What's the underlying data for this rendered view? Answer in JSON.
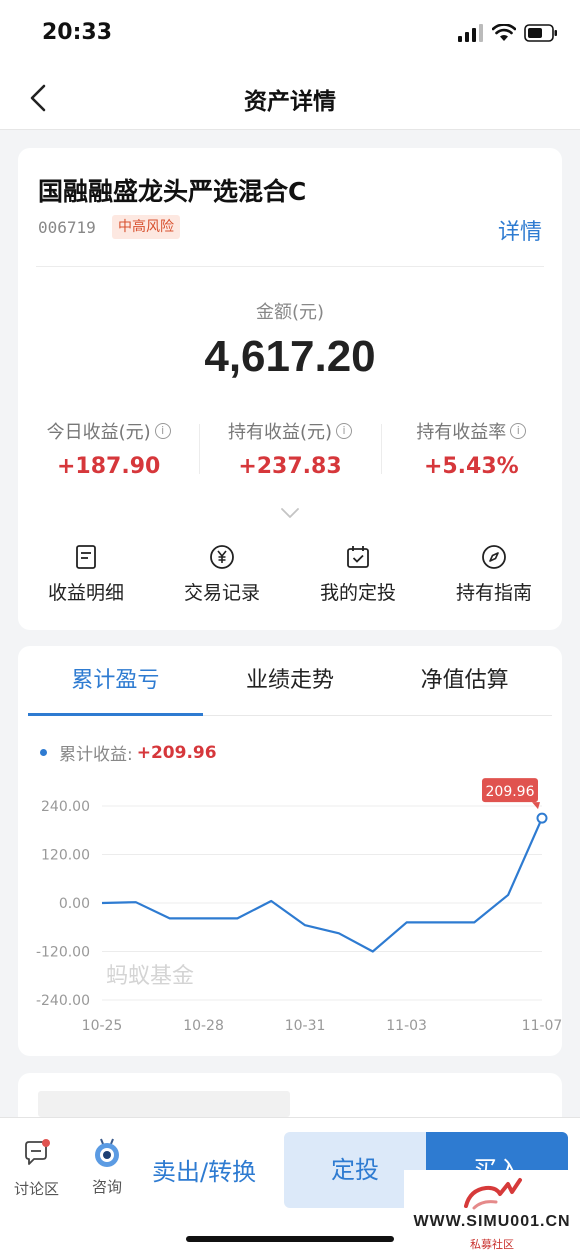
{
  "status_bar": {
    "time": "20:33"
  },
  "nav": {
    "title": "资产详情"
  },
  "fund": {
    "name": "国融融盛龙头严选混合C",
    "code": "006719",
    "risk": "中高风险",
    "detail_link": "详情",
    "amount_label": "金额(元)",
    "amount": "4,617.20",
    "metrics": [
      {
        "label": "今日收益(元)",
        "value": "+187.90"
      },
      {
        "label": "持有收益(元)",
        "value": "+237.83"
      },
      {
        "label": "持有收益率",
        "value": "+5.43%"
      }
    ],
    "actions": [
      {
        "label": "收益明细",
        "icon": "document-icon"
      },
      {
        "label": "交易记录",
        "icon": "yen-circle-icon"
      },
      {
        "label": "我的定投",
        "icon": "calendar-check-icon"
      },
      {
        "label": "持有指南",
        "icon": "compass-icon"
      }
    ]
  },
  "chart_section": {
    "tabs": [
      "累计盈亏",
      "业绩走势",
      "净值估算"
    ],
    "active_tab": 0,
    "legend_name": "累计收益:",
    "legend_value": "+209.96",
    "watermark": "蚂蚁基金"
  },
  "chart_data": {
    "type": "line",
    "series": [
      {
        "name": "累计收益",
        "x": [
          "10-25",
          "10-26",
          "10-27",
          "10-28",
          "10-29",
          "10-30",
          "10-31",
          "11-01",
          "11-02",
          "11-03",
          "11-04",
          "11-05",
          "11-06",
          "11-07"
        ],
        "values": [
          0,
          2,
          -38,
          -38,
          -38,
          5,
          -55,
          -75,
          -120,
          -48,
          -48,
          -48,
          20,
          209.96
        ]
      }
    ],
    "x_tick_labels": [
      "10-25",
      "10-28",
      "10-31",
      "11-03",
      "11-07"
    ],
    "y_tick_labels": [
      "240.00",
      "120.00",
      "0.00",
      "-120.00",
      "-240.00"
    ],
    "ylim": [
      -240,
      240
    ],
    "end_label": "209.96",
    "colors": {
      "line": "#2e7bd1",
      "grid": "#ececec",
      "end_label_bg": "#e0534f"
    }
  },
  "bottom_bar": {
    "discuss_label": "讨论区",
    "consult_label": "咨询",
    "sell_label": "卖出/转换",
    "dingtou_label": "定投",
    "buy_label": "买入"
  },
  "watermark": {
    "site": "WWW.SIMU001.CN",
    "sub": "私募社区"
  },
  "colors": {
    "accent": "#2e7bd1",
    "gain": "#d6373b",
    "risk": "#d8512f"
  }
}
